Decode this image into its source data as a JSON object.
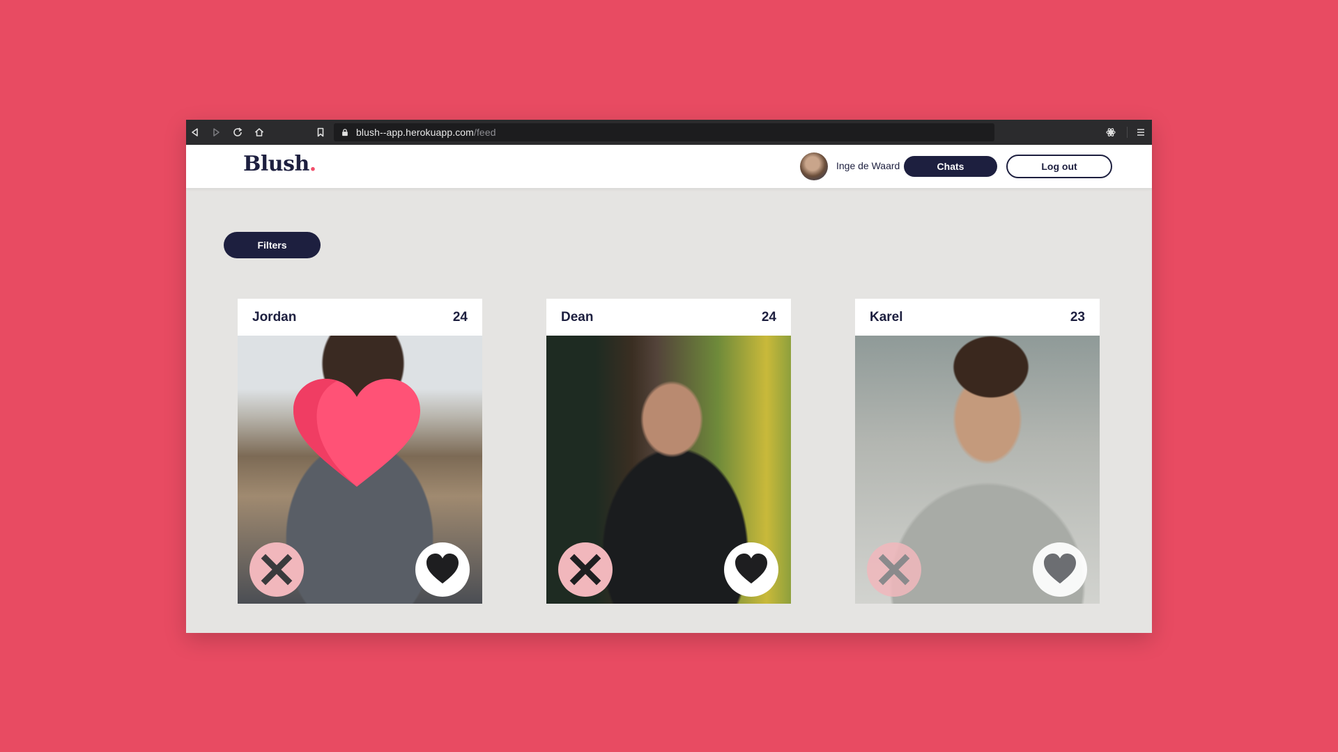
{
  "colors": {
    "background": "#E84B62",
    "navy": "#1D1F3F",
    "accent_pink": "#F24E6A",
    "dislike_pink": "#F1B7BC",
    "panel_bg": "#E5E4E2"
  },
  "browser": {
    "url_host": "blush--app.herokuapp.com",
    "url_path": "/feed",
    "icons": [
      "back-icon",
      "forward-icon",
      "reload-icon",
      "home-icon",
      "bookmark-icon",
      "lock-icon",
      "extension-icon",
      "menu-icon"
    ]
  },
  "header": {
    "logo": "Blush",
    "logo_dot": ".",
    "user_name": "Inge de Waard",
    "chats_label": "Chats",
    "logout_label": "Log out"
  },
  "filters": {
    "label": "Filters"
  },
  "cards": [
    {
      "name": "Jordan",
      "age": "24",
      "liked_overlay": true
    },
    {
      "name": "Dean",
      "age": "24",
      "liked_overlay": false
    },
    {
      "name": "Karel",
      "age": "23",
      "liked_overlay": false
    }
  ]
}
